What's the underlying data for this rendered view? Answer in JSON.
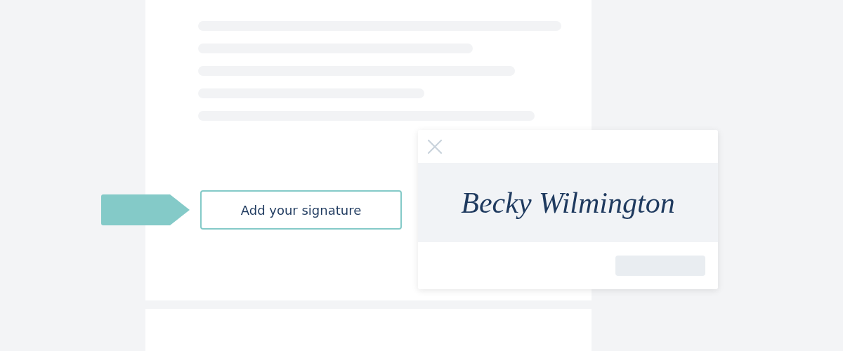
{
  "document": {
    "signature_button": {
      "label": "Add your signature"
    }
  },
  "signature_dialog": {
    "signature": "Becky Wilmington"
  }
}
